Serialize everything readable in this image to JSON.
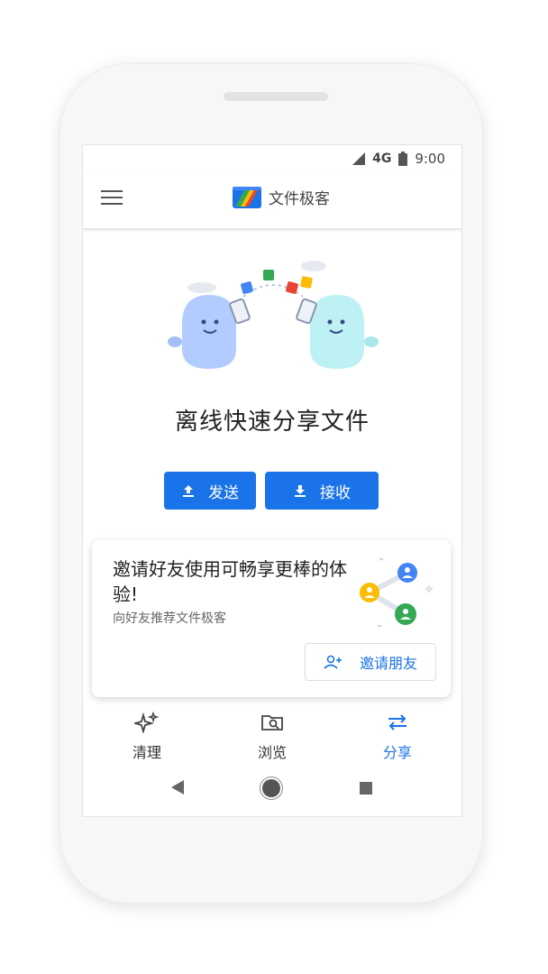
{
  "status": {
    "network": "4G",
    "time": "9:00"
  },
  "app": {
    "title": "文件极客"
  },
  "main": {
    "headline": "离线快速分享文件",
    "send_label": "发送",
    "receive_label": "接收"
  },
  "invite_card": {
    "title": "邀请好友使用可畅享更棒的体验!",
    "subtitle": "向好友推荐文件极客",
    "button_label": "邀请朋友"
  },
  "bottom_nav": {
    "items": [
      {
        "label": "清理",
        "icon": "sparkle-icon"
      },
      {
        "label": "浏览",
        "icon": "folder-search-icon"
      },
      {
        "label": "分享",
        "icon": "swap-arrows-icon"
      }
    ],
    "active": "分享"
  },
  "colors": {
    "accent": "#1a73e8"
  }
}
